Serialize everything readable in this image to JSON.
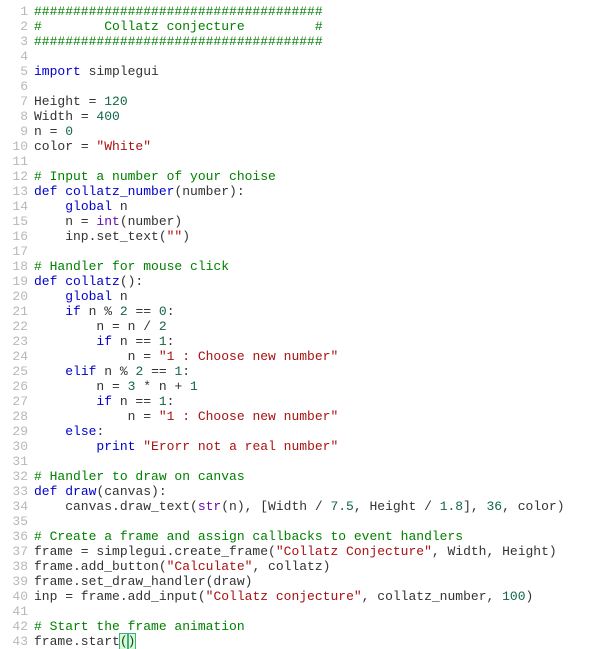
{
  "theme": {
    "comment": "#008000",
    "keyword": "#0000cc",
    "builtin": "#6a0dad",
    "number": "#116644",
    "string": "#aa1111",
    "gutter": "#b8b8b8",
    "text": "#333333",
    "matchbracket_bg": "#d0ffd0"
  },
  "language": "python",
  "title_hint": "Collatz conjecture (Python / simplegui)",
  "gutter": {
    "start": 1,
    "end": 43,
    "lines": [
      "1",
      "2",
      "3",
      "4",
      "5",
      "6",
      "7",
      "8",
      "9",
      "10",
      "11",
      "12",
      "13",
      "14",
      "15",
      "16",
      "17",
      "18",
      "19",
      "20",
      "21",
      "22",
      "23",
      "24",
      "25",
      "26",
      "27",
      "28",
      "29",
      "30",
      "31",
      "32",
      "33",
      "34",
      "35",
      "36",
      "37",
      "38",
      "39",
      "40",
      "41",
      "42",
      "43"
    ]
  },
  "code": {
    "lines": [
      [
        {
          "t": "#####################################",
          "c": "comment"
        }
      ],
      [
        {
          "t": "#        Collatz conjecture         #",
          "c": "comment"
        }
      ],
      [
        {
          "t": "#####################################",
          "c": "comment"
        }
      ],
      [],
      [
        {
          "t": "import",
          "c": "keyword"
        },
        {
          "t": " "
        },
        {
          "t": "simplegui",
          "c": "name"
        }
      ],
      [],
      [
        {
          "t": "Height",
          "c": "name"
        },
        {
          "t": " = "
        },
        {
          "t": "120",
          "c": "number"
        }
      ],
      [
        {
          "t": "Width",
          "c": "name"
        },
        {
          "t": " = "
        },
        {
          "t": "400",
          "c": "number"
        }
      ],
      [
        {
          "t": "n",
          "c": "name"
        },
        {
          "t": " = "
        },
        {
          "t": "0",
          "c": "number"
        }
      ],
      [
        {
          "t": "color",
          "c": "name"
        },
        {
          "t": " = "
        },
        {
          "t": "\"White\"",
          "c": "string"
        }
      ],
      [],
      [
        {
          "t": "# Input a number of your choise",
          "c": "comment"
        }
      ],
      [
        {
          "t": "def",
          "c": "keyword"
        },
        {
          "t": " "
        },
        {
          "t": "collatz_number",
          "c": "def"
        },
        {
          "t": "(number):"
        }
      ],
      [
        {
          "t": "    "
        },
        {
          "t": "global",
          "c": "keyword"
        },
        {
          "t": " n"
        }
      ],
      [
        {
          "t": "    n = "
        },
        {
          "t": "int",
          "c": "builtin"
        },
        {
          "t": "(number)"
        }
      ],
      [
        {
          "t": "    inp.set_text("
        },
        {
          "t": "\"\"",
          "c": "string"
        },
        {
          "t": ")"
        }
      ],
      [],
      [
        {
          "t": "# Handler for mouse click",
          "c": "comment"
        }
      ],
      [
        {
          "t": "def",
          "c": "keyword"
        },
        {
          "t": " "
        },
        {
          "t": "collatz",
          "c": "def"
        },
        {
          "t": "():"
        }
      ],
      [
        {
          "t": "    "
        },
        {
          "t": "global",
          "c": "keyword"
        },
        {
          "t": " n"
        }
      ],
      [
        {
          "t": "    "
        },
        {
          "t": "if",
          "c": "keyword"
        },
        {
          "t": " n % "
        },
        {
          "t": "2",
          "c": "number"
        },
        {
          "t": " == "
        },
        {
          "t": "0",
          "c": "number"
        },
        {
          "t": ":"
        }
      ],
      [
        {
          "t": "        n = n / "
        },
        {
          "t": "2",
          "c": "number"
        }
      ],
      [
        {
          "t": "        "
        },
        {
          "t": "if",
          "c": "keyword"
        },
        {
          "t": " n == "
        },
        {
          "t": "1",
          "c": "number"
        },
        {
          "t": ":"
        }
      ],
      [
        {
          "t": "            n = "
        },
        {
          "t": "\"1 : Choose new number\"",
          "c": "string"
        }
      ],
      [
        {
          "t": "    "
        },
        {
          "t": "elif",
          "c": "keyword"
        },
        {
          "t": " n % "
        },
        {
          "t": "2",
          "c": "number"
        },
        {
          "t": " == "
        },
        {
          "t": "1",
          "c": "number"
        },
        {
          "t": ":"
        }
      ],
      [
        {
          "t": "        n = "
        },
        {
          "t": "3",
          "c": "number"
        },
        {
          "t": " * n + "
        },
        {
          "t": "1",
          "c": "number"
        }
      ],
      [
        {
          "t": "        "
        },
        {
          "t": "if",
          "c": "keyword"
        },
        {
          "t": " n == "
        },
        {
          "t": "1",
          "c": "number"
        },
        {
          "t": ":"
        }
      ],
      [
        {
          "t": "            n = "
        },
        {
          "t": "\"1 : Choose new number\"",
          "c": "string"
        }
      ],
      [
        {
          "t": "    "
        },
        {
          "t": "else",
          "c": "keyword"
        },
        {
          "t": ":"
        }
      ],
      [
        {
          "t": "        "
        },
        {
          "t": "print",
          "c": "keyword"
        },
        {
          "t": " "
        },
        {
          "t": "\"Erorr not a real number\"",
          "c": "string"
        }
      ],
      [],
      [
        {
          "t": "# Handler to draw on canvas",
          "c": "comment"
        }
      ],
      [
        {
          "t": "def",
          "c": "keyword"
        },
        {
          "t": " "
        },
        {
          "t": "draw",
          "c": "def"
        },
        {
          "t": "(canvas):"
        }
      ],
      [
        {
          "t": "    canvas.draw_text("
        },
        {
          "t": "str",
          "c": "builtin"
        },
        {
          "t": "(n), [Width / "
        },
        {
          "t": "7.5",
          "c": "number"
        },
        {
          "t": ", Height / "
        },
        {
          "t": "1.8",
          "c": "number"
        },
        {
          "t": "], "
        },
        {
          "t": "36",
          "c": "number"
        },
        {
          "t": ", color)"
        }
      ],
      [],
      [
        {
          "t": "# Create a frame and assign callbacks to event handlers",
          "c": "comment"
        }
      ],
      [
        {
          "t": "frame = simplegui.create_frame("
        },
        {
          "t": "\"Collatz Conjecture\"",
          "c": "string"
        },
        {
          "t": ", Width, Height)"
        }
      ],
      [
        {
          "t": "frame.add_button("
        },
        {
          "t": "\"Calculate\"",
          "c": "string"
        },
        {
          "t": ", collatz)"
        }
      ],
      [
        {
          "t": "frame.set_draw_handler(draw)"
        }
      ],
      [
        {
          "t": "inp = frame.add_input("
        },
        {
          "t": "\"Collatz conjecture\"",
          "c": "string"
        },
        {
          "t": ", collatz_number, "
        },
        {
          "t": "100",
          "c": "number"
        },
        {
          "t": ")"
        }
      ],
      [],
      [
        {
          "t": "# Start the frame animation",
          "c": "comment"
        }
      ],
      [
        {
          "t": "frame.start"
        },
        {
          "t": "(",
          "c": "matchbracket"
        },
        {
          "t": ")",
          "c": "matchbracket"
        }
      ]
    ]
  }
}
